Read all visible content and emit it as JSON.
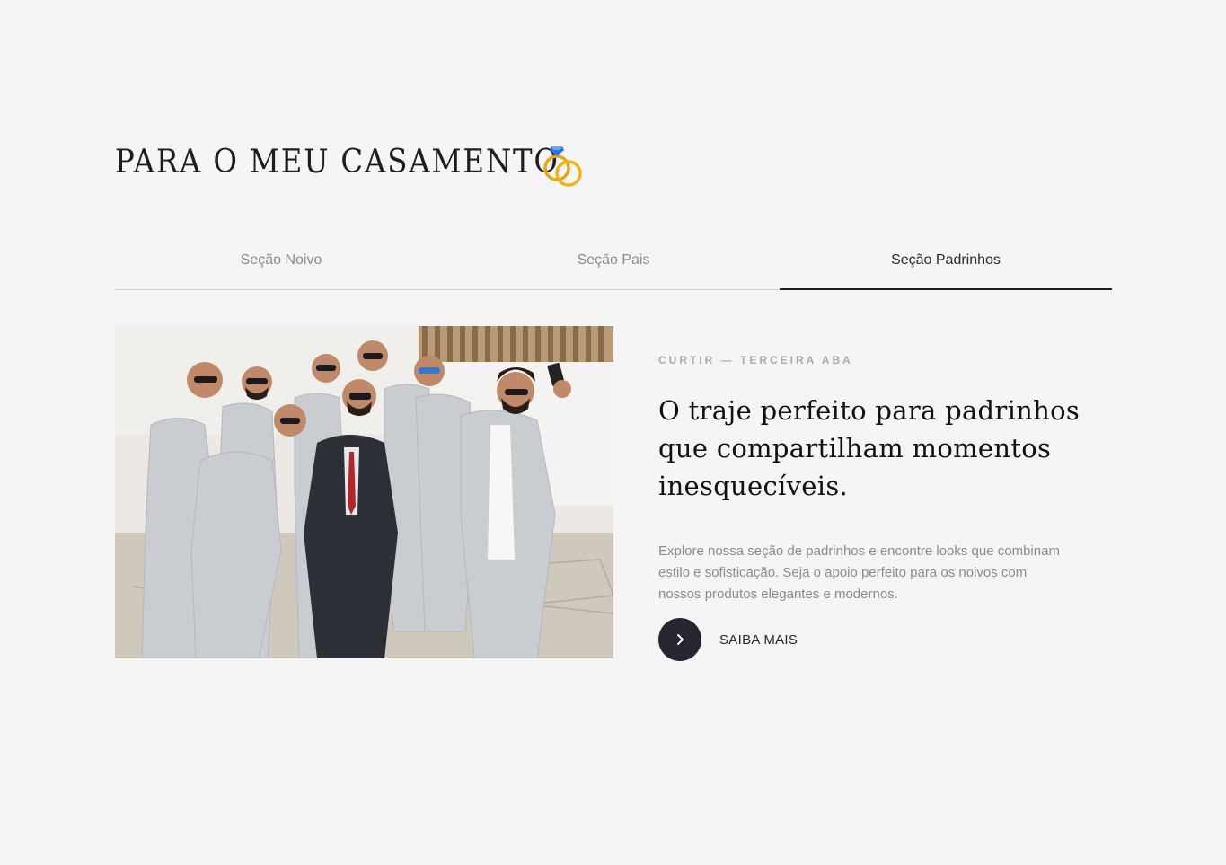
{
  "section": {
    "title": "PARA O MEU CASAMENTO",
    "title_icon": "wedding-rings-icon"
  },
  "tabs": [
    {
      "label": "Seção Noivo",
      "active": false
    },
    {
      "label": "Seção Pais",
      "active": false
    },
    {
      "label": "Seção Padrinhos",
      "active": true
    }
  ],
  "content": {
    "eyebrow": "CURTIR — TERCEIRA ABA",
    "headline": "O traje perfeito para padrinhos que compartilham momentos inesquecíveis.",
    "body": "Explore nossa seção de padrinhos e encontre looks que combinam estilo e sofisticação. Seja o apoio perfeito para os noivos com nossos produtos elegantes e modernos.",
    "cta_label": "SAIBA MAIS",
    "cta_icon": "chevron-right-icon"
  },
  "colors": {
    "background": "#f5f5f5",
    "text_dark": "#1d1d1f",
    "text_muted": "#8b8b8b",
    "button": "#25262f",
    "ring_gold": "#e8a517",
    "gem_blue": "#2f6fe0"
  }
}
